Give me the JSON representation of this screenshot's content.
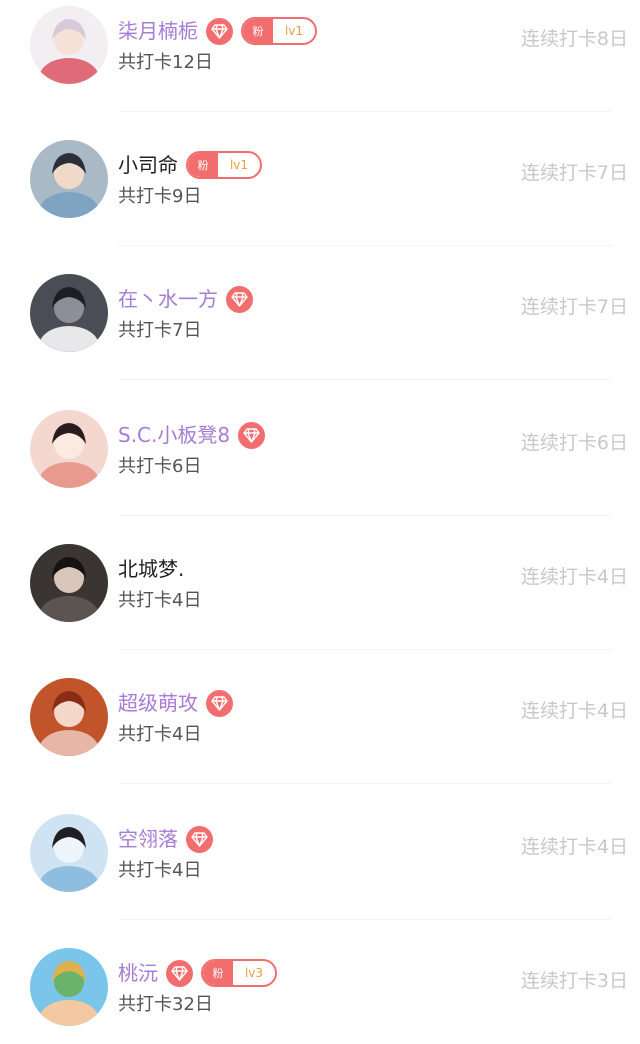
{
  "checkin_list": [
    {
      "name": "柒月楠栀",
      "vip": true,
      "gem": true,
      "fan_badge": {
        "label": "粉",
        "level": "lv1"
      },
      "total": "共打卡12日",
      "streak": "连续打卡8日",
      "avatar_colors": {
        "bg": "#f3eef2",
        "a": "#d9c8d9",
        "b": "#e06b78",
        "c": "#f5e2d6"
      }
    },
    {
      "name": "小司命",
      "vip": false,
      "gem": false,
      "fan_badge": {
        "label": "粉",
        "level": "lv1"
      },
      "total": "共打卡9日",
      "streak": "连续打卡7日",
      "avatar_colors": {
        "bg": "#a9b9c6",
        "a": "#2c2f3a",
        "b": "#7fa3c2",
        "c": "#f0d9c8"
      }
    },
    {
      "name": "在丶水一方",
      "vip": true,
      "gem": true,
      "fan_badge": null,
      "total": "共打卡7日",
      "streak": "连续打卡7日",
      "avatar_colors": {
        "bg": "#4a4d55",
        "a": "#1d1e24",
        "b": "#e8e8ea",
        "c": "#8c8f97"
      }
    },
    {
      "name": "S.C.小板凳8",
      "vip": true,
      "gem": true,
      "fan_badge": null,
      "total": "共打卡6日",
      "streak": "连续打卡6日",
      "avatar_colors": {
        "bg": "#f4d7cf",
        "a": "#2a1c1c",
        "b": "#e99a8e",
        "c": "#fbe9e2"
      }
    },
    {
      "name": "北城梦.",
      "vip": false,
      "gem": false,
      "fan_badge": null,
      "total": "共打卡4日",
      "streak": "连续打卡4日",
      "avatar_colors": {
        "bg": "#3a3533",
        "a": "#151212",
        "b": "#5c5450",
        "c": "#d8c6bb"
      }
    },
    {
      "name": "超级萌攻",
      "vip": true,
      "gem": true,
      "fan_badge": null,
      "total": "共打卡4日",
      "streak": "连续打卡4日",
      "avatar_colors": {
        "bg": "#c2542b",
        "a": "#8a2d16",
        "b": "#e8b6a6",
        "c": "#f3d7c9"
      }
    },
    {
      "name": "空翎落",
      "vip": true,
      "gem": true,
      "fan_badge": null,
      "total": "共打卡4日",
      "streak": "连续打卡4日",
      "avatar_colors": {
        "bg": "#cfe3f2",
        "a": "#1f1f24",
        "b": "#8fbde0",
        "c": "#eef5fb"
      }
    },
    {
      "name": "桃沅",
      "vip": true,
      "gem": true,
      "fan_badge": {
        "label": "粉",
        "level": "lv3"
      },
      "total": "共打卡32日",
      "streak": "连续打卡3日",
      "avatar_colors": {
        "bg": "#7cc5ea",
        "a": "#e0b04a",
        "b": "#f3c9a2",
        "c": "#6ab36a"
      }
    }
  ],
  "colors": {
    "vip_name": "#a77bd6",
    "normal_name": "#222222",
    "gem_bg": "#f26d6d",
    "fan_border": "#f26d6d",
    "fan_level": "#e6a23c",
    "total_text": "#555555",
    "streak_text": "#c8c8c8"
  },
  "icons": {
    "gem": "diamond-icon"
  }
}
